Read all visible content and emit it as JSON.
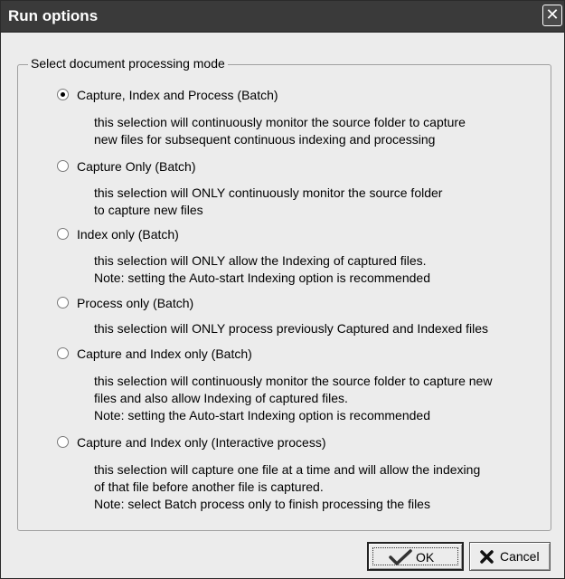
{
  "window": {
    "title": "Run options",
    "close_symbol": "✕"
  },
  "group": {
    "legend": "Select document processing mode"
  },
  "options": [
    {
      "label": "Capture, Index and Process (Batch)",
      "selected": true,
      "description": [
        "this selection will continuously monitor the source folder to capture",
        "new files for subsequent continuous indexing and processing"
      ]
    },
    {
      "label": "Capture Only (Batch)",
      "selected": false,
      "description": [
        "this selection will ONLY continuously monitor the source folder",
        "to capture new files"
      ]
    },
    {
      "label": "Index only (Batch)",
      "selected": false,
      "description": [
        "this selection will ONLY allow the Indexing of captured files.",
        "Note: setting the Auto-start Indexing option is recommended"
      ]
    },
    {
      "label": "Process only (Batch)",
      "selected": false,
      "description": [
        "this selection will ONLY process previously Captured and Indexed files"
      ]
    },
    {
      "label": "Capture and Index only (Batch)",
      "selected": false,
      "description": [
        "this selection will continuously monitor the source folder to capture new",
        "files and also allow Indexing of captured files.",
        "Note: setting the Auto-start Indexing option is recommended"
      ]
    },
    {
      "label": "Capture and Index only (Interactive process)",
      "selected": false,
      "description": [
        "this selection will capture one file at a time and will allow the indexing",
        "of that file before another file is captured.",
        "Note: select Batch process only to finish processing the files"
      ]
    }
  ],
  "buttons": {
    "ok_label": "OK",
    "ok_icon": "checkmark-icon",
    "cancel_label": "Cancel",
    "cancel_icon": "x-mark-icon"
  }
}
